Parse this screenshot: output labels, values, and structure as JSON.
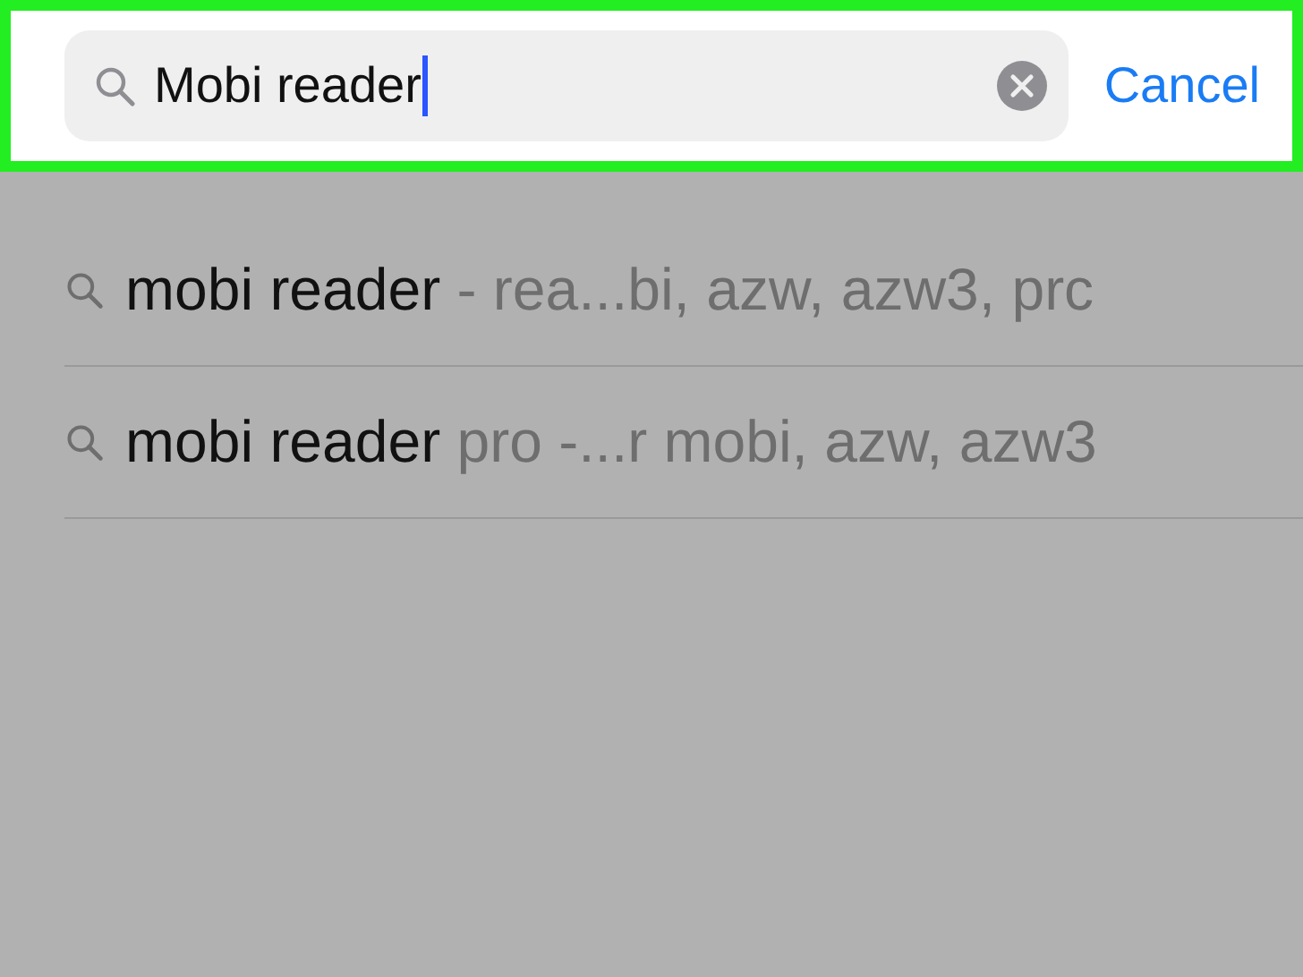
{
  "search": {
    "value": "Mobi reader",
    "cancel": "Cancel"
  },
  "suggestions": [
    {
      "match": "mobi reader",
      "rest": " - rea...bi, azw, azw3, prc"
    },
    {
      "match": "mobi reader",
      "rest": " pro -...r mobi, azw, azw3"
    }
  ]
}
